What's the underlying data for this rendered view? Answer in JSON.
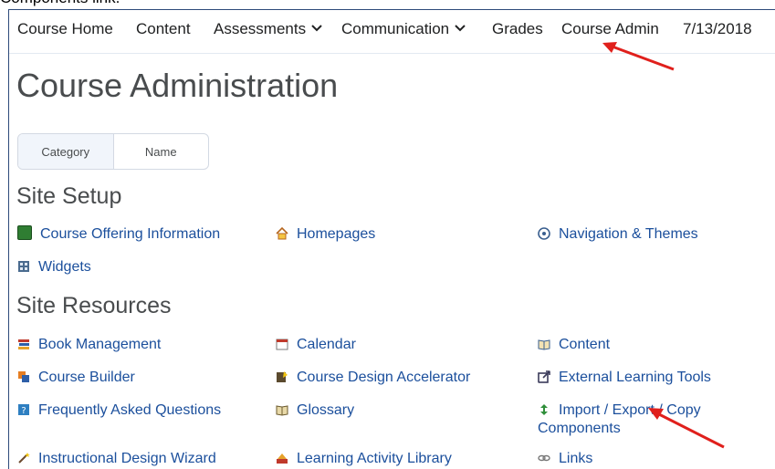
{
  "caption": "Components link.",
  "nav": {
    "items": [
      {
        "label": "Course Home"
      },
      {
        "label": "Content"
      },
      {
        "label": "Assessments"
      },
      {
        "label": "Communication"
      },
      {
        "label": "Grades"
      },
      {
        "label": "Course Admin"
      },
      {
        "label": "7/13/2018"
      }
    ]
  },
  "page_title": "Course Administration",
  "view_toggle": {
    "category": "Category",
    "name": "Name",
    "selected": "Category"
  },
  "site_setup": {
    "heading": "Site Setup",
    "tools": [
      {
        "label": "Course Offering Information",
        "icon": "book-green-icon"
      },
      {
        "label": "Homepages",
        "icon": "home-icon"
      },
      {
        "label": "Navigation & Themes",
        "icon": "compass-icon"
      },
      {
        "label": "Widgets",
        "icon": "widgets-icon"
      }
    ]
  },
  "site_resources": {
    "heading": "Site Resources",
    "tools": [
      {
        "label": "Book Management",
        "icon": "books-icon"
      },
      {
        "label": "Calendar",
        "icon": "calendar-icon"
      },
      {
        "label": "Content",
        "icon": "open-book-icon"
      },
      {
        "label": "Course Builder",
        "icon": "builder-icon"
      },
      {
        "label": "Course Design Accelerator",
        "icon": "accelerator-icon"
      },
      {
        "label": "External Learning Tools",
        "icon": "external-tools-icon"
      },
      {
        "label": "Frequently Asked Questions",
        "icon": "faq-icon"
      },
      {
        "label": "Glossary",
        "icon": "glossary-icon"
      },
      {
        "label": "Import / Export / Copy",
        "label_line2": "Components",
        "icon": "import-export-icon"
      },
      {
        "label": "Instructional Design Wizard",
        "icon": "wand-icon"
      },
      {
        "label": "Learning Activity Library",
        "icon": "library-icon"
      },
      {
        "label": "Links",
        "icon": "link-icon"
      }
    ]
  },
  "colors": {
    "link": "#1b4f9c",
    "heading": "#494c4e",
    "annotation_arrow": "#e0201c"
  }
}
